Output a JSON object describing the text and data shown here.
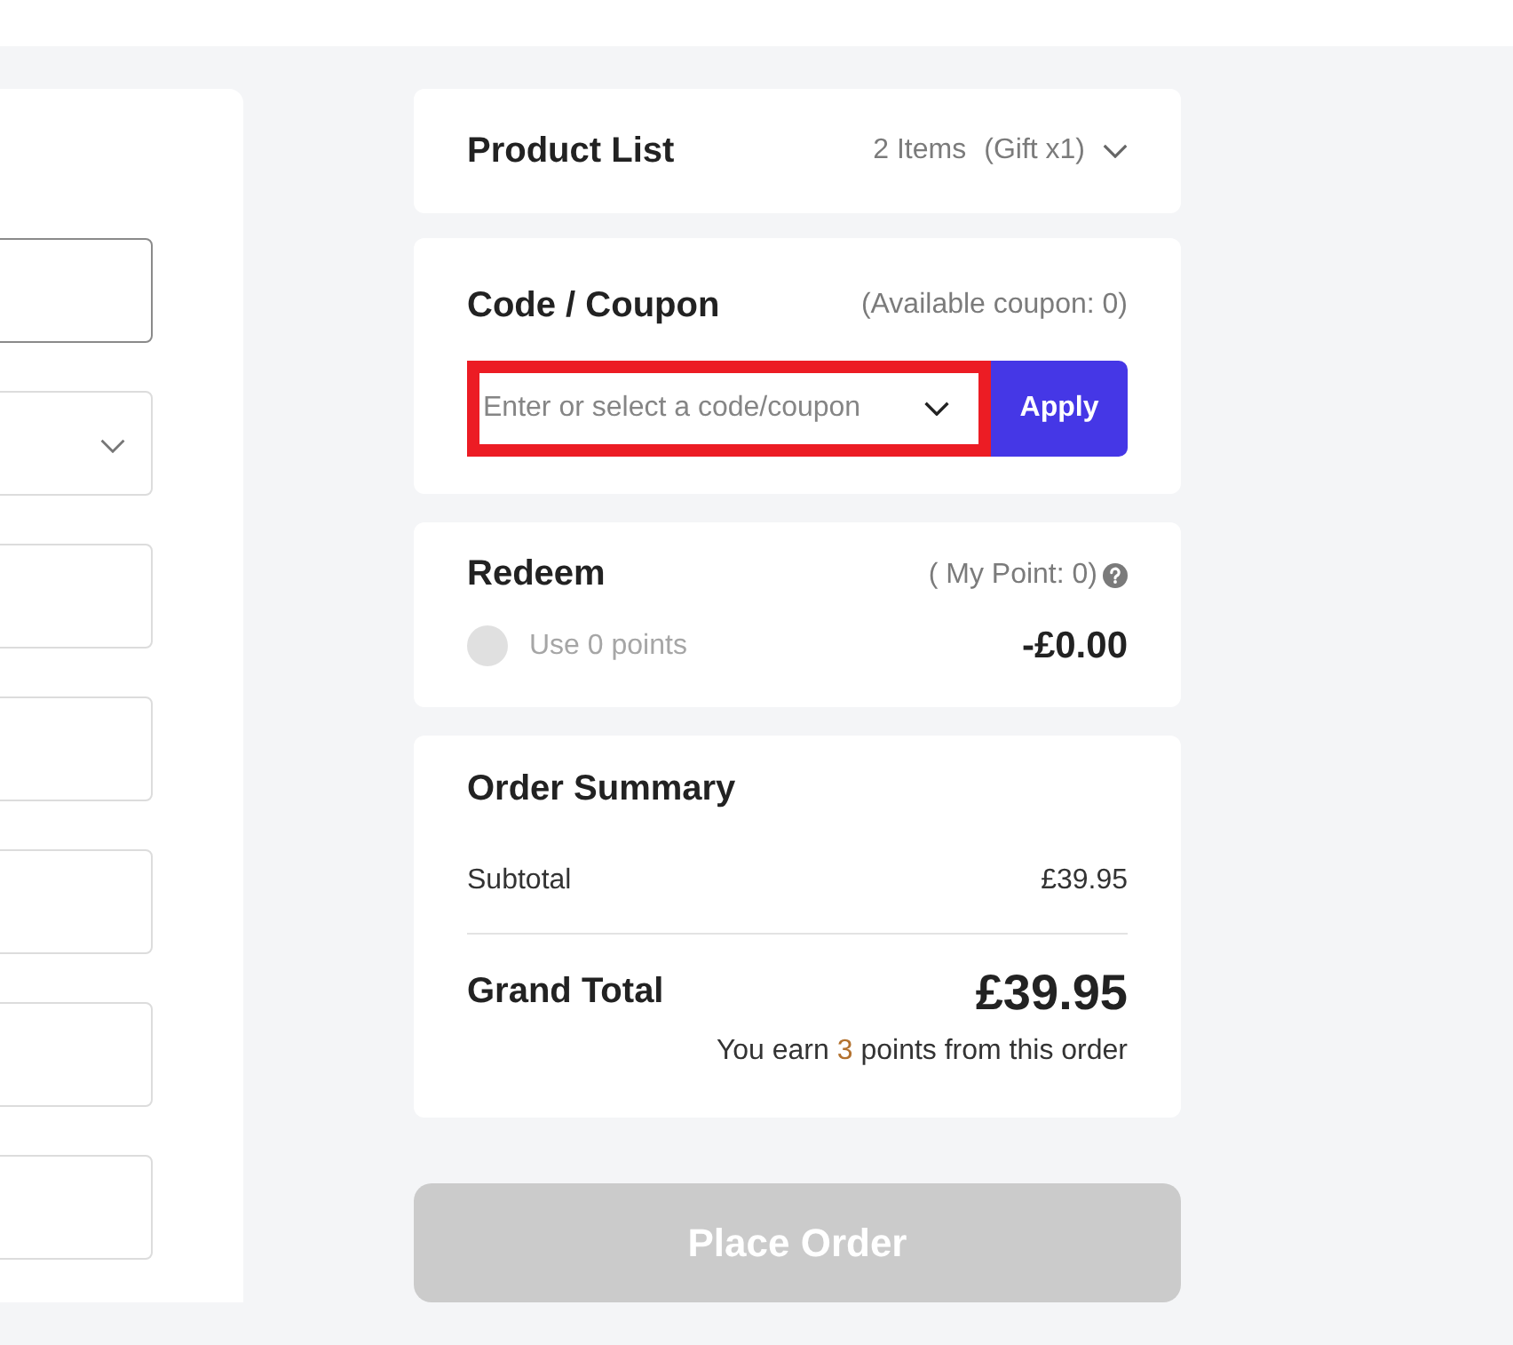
{
  "left_form": {
    "fields": [
      {
        "kind": "text",
        "focused": true
      },
      {
        "kind": "select",
        "focused": false
      },
      {
        "kind": "text",
        "focused": false
      },
      {
        "kind": "text",
        "focused": false
      },
      {
        "kind": "text",
        "focused": false
      },
      {
        "kind": "text",
        "focused": false
      },
      {
        "kind": "text",
        "focused": false
      }
    ]
  },
  "product_list": {
    "title": "Product List",
    "count": "2 Items",
    "gift": "(Gift x1)",
    "expanded": false
  },
  "coupon": {
    "title": "Code / Coupon",
    "available": "(Available coupon: 0)",
    "field": {
      "placeholder": "Enter or select a code/coupon",
      "highlighted": true
    },
    "apply_button": "Apply"
  },
  "redeem": {
    "title": "Redeem",
    "my_point": "( My Point: 0)",
    "option": {
      "label": "Use 0 points",
      "checked": false,
      "disabled": true
    },
    "amount": "-£0.00"
  },
  "order_summary": {
    "title": "Order Summary",
    "rows": [
      {
        "label": "Subtotal",
        "value": "£39.95"
      }
    ],
    "grand_total": {
      "label": "Grand Total",
      "value": "£39.95"
    },
    "earn_note": {
      "before": "You earn",
      "points": "3",
      "after": "points from this order"
    }
  },
  "place_order": {
    "label": "Place Order",
    "disabled": true
  }
}
